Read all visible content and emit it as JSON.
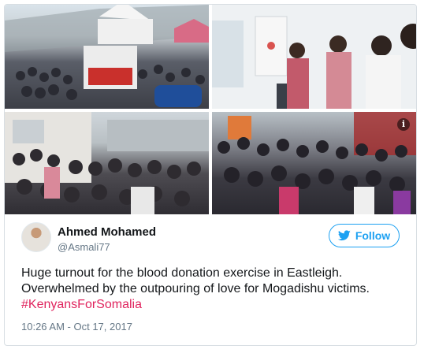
{
  "tweet": {
    "author_name": "Ahmed Mohamed",
    "author_handle": "@Asmali77",
    "follow_label": "Follow",
    "text_line1": "Huge turnout for the blood donation exercise in Eastleigh.",
    "text_line2": "Overwhelmed by the outpouring of love for Mogadishu victims.",
    "hashtag": "#KenyansForSomalia",
    "timestamp": "10:26 AM - Oct 17, 2017"
  },
  "photos": [
    {
      "name": "crowd-street-tent-photo"
    },
    {
      "name": "donation-van-interior-photo"
    },
    {
      "name": "crowd-bus-photo"
    },
    {
      "name": "crowd-outside-photo"
    }
  ],
  "icons": {
    "info": "info-icon",
    "twitter": "twitter-bird-icon"
  },
  "colors": {
    "accent": "#1da1f2",
    "hashtag": "#e0245e",
    "meta": "#657786"
  }
}
